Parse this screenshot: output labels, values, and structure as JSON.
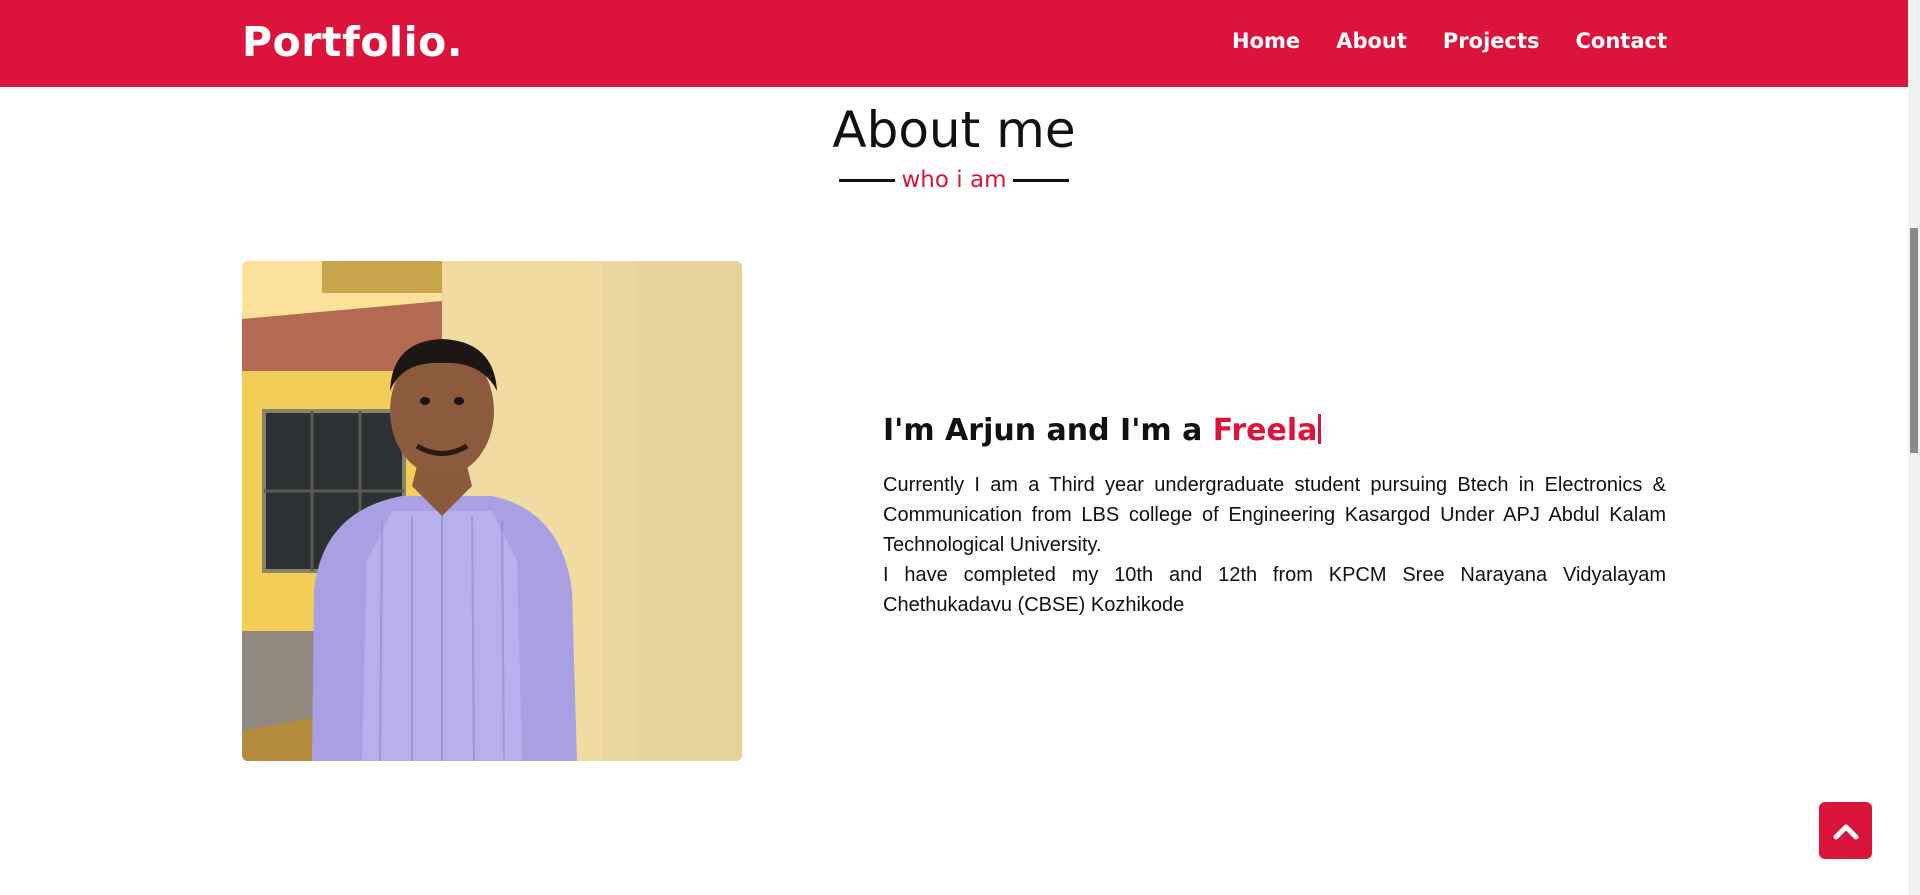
{
  "navbar": {
    "logo": "Portfolio.",
    "items": [
      {
        "label": "Home"
      },
      {
        "label": "About"
      },
      {
        "label": "Projects"
      },
      {
        "label": "Contact"
      }
    ],
    "bg_color": "#dc143c"
  },
  "about": {
    "title": "About me",
    "subtitle": "who i am",
    "intro_prefix": "I'm Arjun and I'm a ",
    "typed_text": "Freela",
    "paragraphs": [
      "Currently I am a Third year undergraduate student pursuing Btech in Electronics & Communication from LBS college of Engineering Kasargod Under APJ Abdul Kalam Technological University.",
      "I have completed my 10th and 12th from KPCM Sree Narayana Vidyalayam Chethukadavu (CBSE) Kozhikode"
    ]
  },
  "back_to_top": {
    "icon": "chevron-up-icon"
  },
  "accent_color": "#dc143c"
}
